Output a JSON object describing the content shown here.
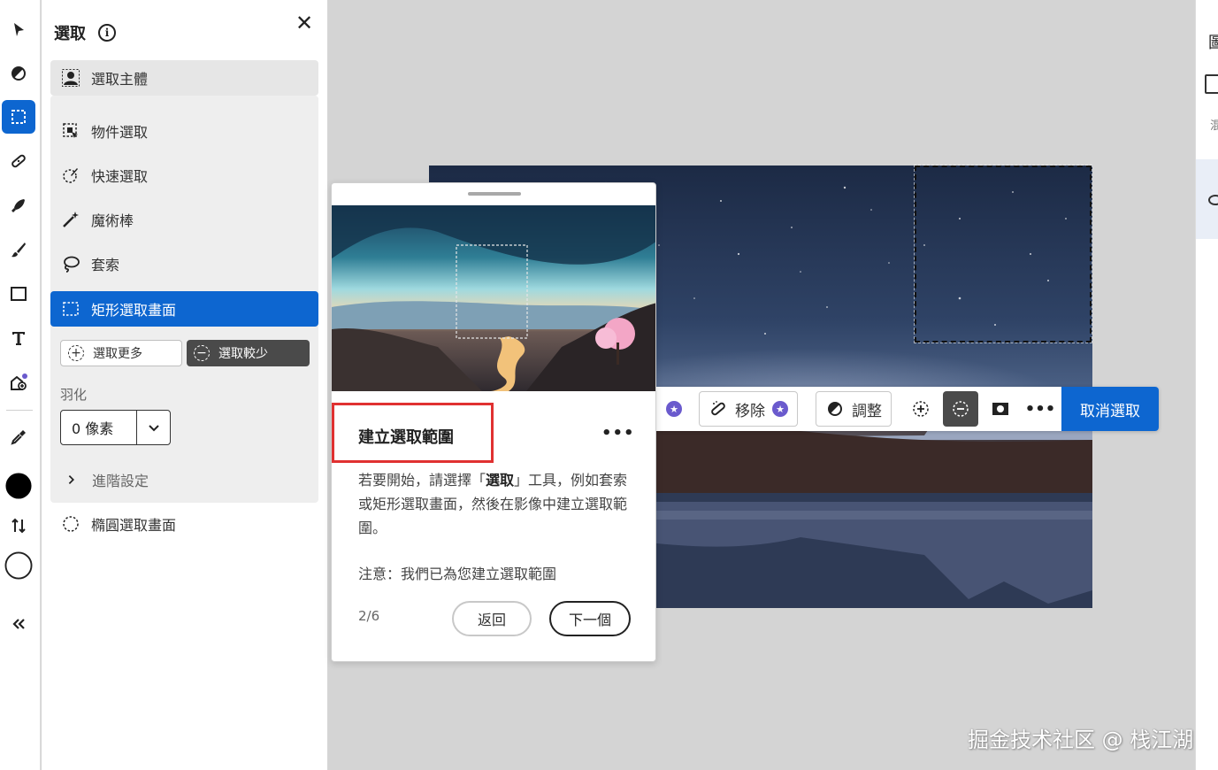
{
  "panel": {
    "title": "選取",
    "subject_label": "選取主體",
    "items": [
      {
        "label": "物件選取"
      },
      {
        "label": "快速選取"
      },
      {
        "label": "魔術棒"
      },
      {
        "label": "套索"
      },
      {
        "label": "矩形選取畫面"
      }
    ],
    "add_label": "選取更多",
    "subtract_label": "選取較少",
    "feather_label": "羽化",
    "feather_value": "0 像素",
    "advanced_label": "進階設定",
    "ellipse_label": "橢圓選取畫面"
  },
  "context_bar": {
    "remove_label": "移除",
    "adjust_label": "調整",
    "deselect_label": "取消選取"
  },
  "card": {
    "title": "建立選取範圍",
    "body_prefix": "若要開始，請選擇「",
    "body_bold": "選取",
    "body_suffix": "」工具，例如套索或矩形選取畫面，然後在影像中建立選取範圍。",
    "note": "注意：我們已為您建立選取範圍",
    "page": "2/6",
    "back_label": "返回",
    "next_label": "下一個"
  },
  "right_panel": {
    "glyph_1": "圖",
    "glyph_2": "混"
  },
  "watermark": "掘金技术社区 @ 栈江湖",
  "colors": {
    "accent": "#0d66d0",
    "highlight_border": "#e03131",
    "dark_button": "#4a4a4a"
  }
}
